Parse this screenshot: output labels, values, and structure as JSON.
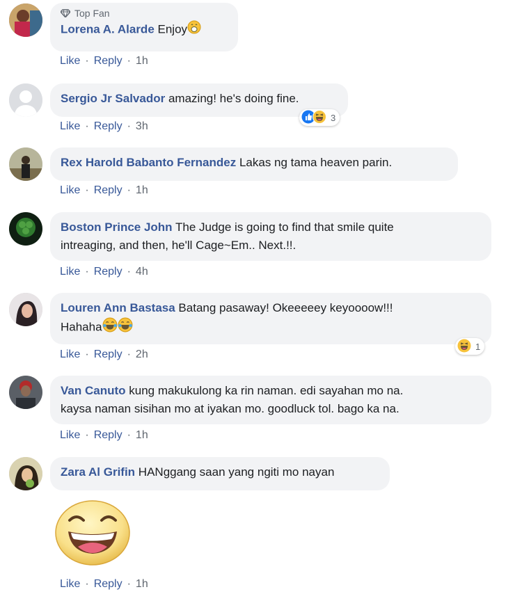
{
  "labels": {
    "like": "Like",
    "reply": "Reply",
    "dot": "·"
  },
  "badge": {
    "top_fan": "Top Fan"
  },
  "comments": [
    {
      "name": "Lorena A. Alarde",
      "text": "Enjoy",
      "time": "1h"
    },
    {
      "name": "Sergio Jr Salvador",
      "text": "amazing! he's doing fine.",
      "time": "3h",
      "reaction_count": "3"
    },
    {
      "name": "Rex Harold Babanto Fernandez",
      "text": "Lakas ng tama heaven parin.",
      "time": "1h"
    },
    {
      "name": "Boston Prince John",
      "text": "The Judge is going to find that smile quite",
      "text2": "intreaging, and then, he'll Cage~Em.. Next.!!.",
      "time": "4h"
    },
    {
      "name": "Louren Ann Bastasa",
      "text": "Batang pasaway! Okeeeeey keyoooow!!!",
      "text2": "Hahaha",
      "time": "2h",
      "reaction_count": "1"
    },
    {
      "name": "Van Canuto",
      "text": "kung makukulong ka rin naman. edi sayahan mo na.",
      "text2": "kaysa naman sisihan mo at iyakan mo. goodluck tol. bago ka na.",
      "time": "1h"
    },
    {
      "name": "Zara Al Grifin",
      "text": "HANggang saan yang ngiti mo nayan",
      "time": "1h"
    }
  ],
  "colors": {
    "link": "#385898",
    "bubble": "#f2f3f5",
    "meta": "#606770"
  }
}
